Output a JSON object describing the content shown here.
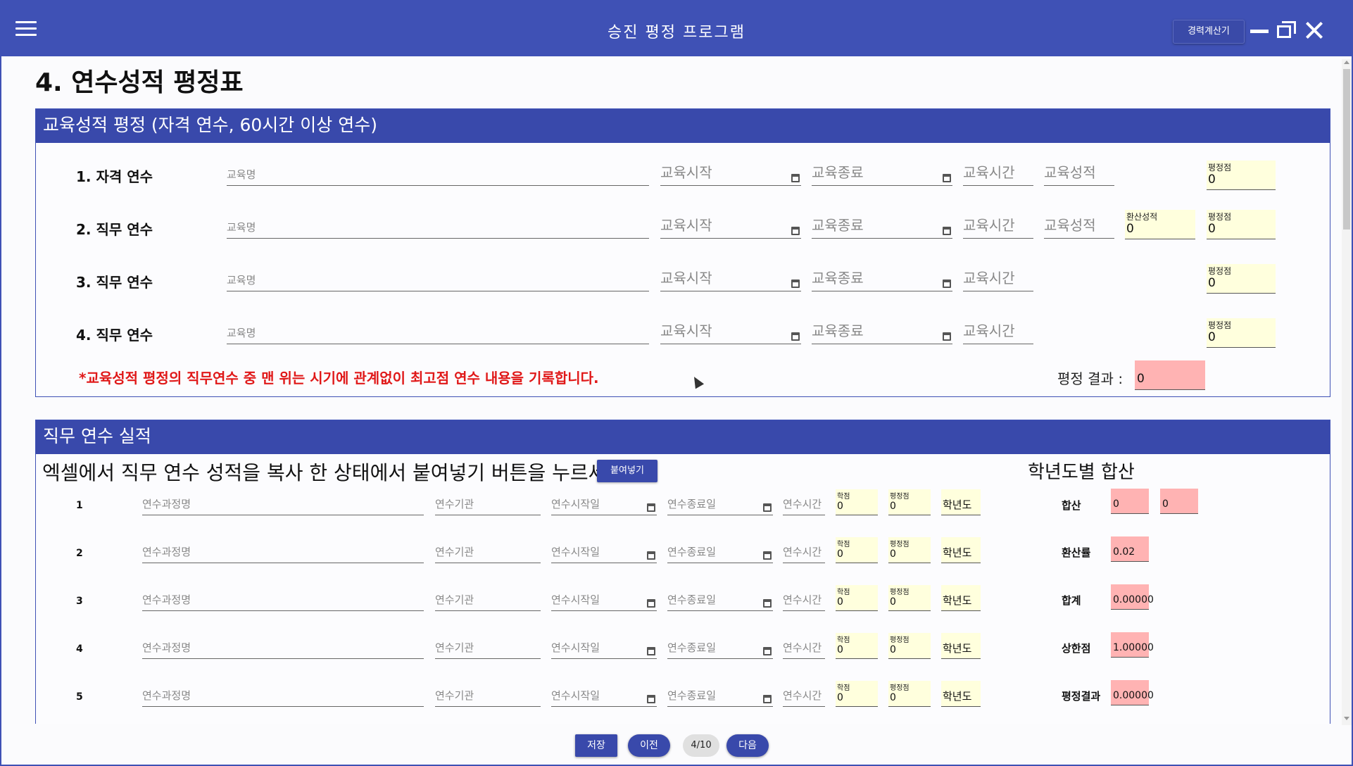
{
  "window": {
    "title": "승진 평정 프로그램",
    "career_calc_label": "경력계산기"
  },
  "page_title": "4. 연수성적 평정표",
  "education_section": {
    "header": "교육성적 평정 (자격 연수, 60시간 이상 연수)",
    "rows": [
      {
        "label": "1. 자격 연수",
        "name_placeholder": "교육명",
        "start_placeholder": "교육시작",
        "end_placeholder": "교육종료",
        "hours_placeholder": "교육시간",
        "grade_placeholder": "교육성적",
        "score_label": "평정점",
        "score_value": "0"
      },
      {
        "label": "2. 직무 연수",
        "name_placeholder": "교육명",
        "start_placeholder": "교육시작",
        "end_placeholder": "교육종료",
        "hours_placeholder": "교육시간",
        "grade_placeholder": "교육성적",
        "converted_label": "환산성적",
        "converted_value": "0",
        "score_label": "평정점",
        "score_value": "0"
      },
      {
        "label": "3. 직무 연수",
        "name_placeholder": "교육명",
        "start_placeholder": "교육시작",
        "end_placeholder": "교육종료",
        "hours_placeholder": "교육시간",
        "score_label": "평정점",
        "score_value": "0"
      },
      {
        "label": "4. 직무 연수",
        "name_placeholder": "교육명",
        "start_placeholder": "교육시작",
        "end_placeholder": "교육종료",
        "hours_placeholder": "교육시간",
        "score_label": "평정점",
        "score_value": "0"
      }
    ],
    "warning": "*교육성적 평정의 직무연수 중 맨 위는 시기에 관계없이 최고점 연수 내용을 기록합니다.",
    "result_label": "평정 결과 :",
    "result_value": "0"
  },
  "job_training_section": {
    "header": "직무 연수 실적",
    "instruction": "엑셀에서 직무 연수 성적을 복사 한 상태에서 붙여넣기 버튼을 누르세요.",
    "paste_label": "붙여넣기",
    "rows": [
      {
        "num": "1",
        "course_ph": "연수과정명",
        "org_ph": "연수기관",
        "start_ph": "연수시작일",
        "end_ph": "연수종료일",
        "hours_ph": "연수시간",
        "credit_label": "학점",
        "credit_value": "0",
        "score_label": "평정점",
        "score_value": "0",
        "year_value": "학년도"
      },
      {
        "num": "2",
        "course_ph": "연수과정명",
        "org_ph": "연수기관",
        "start_ph": "연수시작일",
        "end_ph": "연수종료일",
        "hours_ph": "연수시간",
        "credit_label": "학점",
        "credit_value": "0",
        "score_label": "평정점",
        "score_value": "0",
        "year_value": "학년도"
      },
      {
        "num": "3",
        "course_ph": "연수과정명",
        "org_ph": "연수기관",
        "start_ph": "연수시작일",
        "end_ph": "연수종료일",
        "hours_ph": "연수시간",
        "credit_label": "학점",
        "credit_value": "0",
        "score_label": "평정점",
        "score_value": "0",
        "year_value": "학년도"
      },
      {
        "num": "4",
        "course_ph": "연수과정명",
        "org_ph": "연수기관",
        "start_ph": "연수시작일",
        "end_ph": "연수종료일",
        "hours_ph": "연수시간",
        "credit_label": "학점",
        "credit_value": "0",
        "score_label": "평정점",
        "score_value": "0",
        "year_value": "학년도"
      },
      {
        "num": "5",
        "course_ph": "연수과정명",
        "org_ph": "연수기관",
        "start_ph": "연수시작일",
        "end_ph": "연수종료일",
        "hours_ph": "연수시간",
        "credit_label": "학점",
        "credit_value": "0",
        "score_label": "평정점",
        "score_value": "0",
        "year_value": "학년도"
      }
    ],
    "yearly": {
      "title": "학년도별 합산",
      "sum_label": "합산",
      "sum_value_1": "0",
      "sum_value_2": "0",
      "rate_label": "환산률",
      "rate_value": "0.02",
      "total_label": "합계",
      "total_value": "0.00000",
      "cap_label": "상한점",
      "cap_value": "1.00000",
      "result_label": "평정결과",
      "result_value": "0.00000"
    }
  },
  "footer": {
    "save_label": "저장",
    "prev_label": "이전",
    "page_indicator": "4/10",
    "next_label": "다음"
  }
}
